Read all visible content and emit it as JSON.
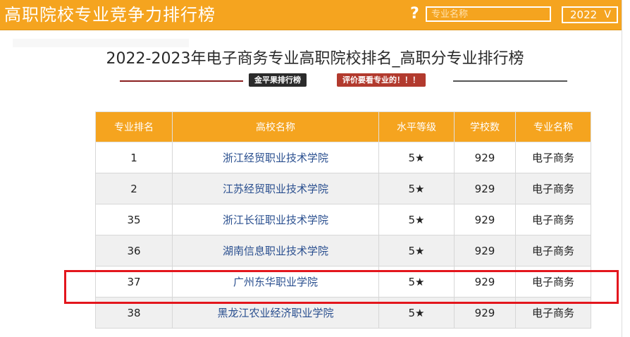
{
  "header": {
    "app_title": "高职院校专业竞争力排行榜",
    "help_icon": "?",
    "search_placeholder": "专业名称",
    "year_value": "2022",
    "year_chevron": "V"
  },
  "page": {
    "title": "2022-2023年电子商务专业高职院校排名_高职分专业排行榜",
    "badge_left": "金平果排行榜",
    "badge_right": "评价要看专业的！！！"
  },
  "table": {
    "headers": [
      "专业排名",
      "高校名称",
      "水平等级",
      "学校数",
      "专业名称"
    ],
    "rows": [
      {
        "rank": "1",
        "school": "浙江经贸职业技术学院",
        "level": "5★",
        "count": "929",
        "major": "电子商务"
      },
      {
        "rank": "2",
        "school": "江苏经贸职业技术学院",
        "level": "5★",
        "count": "929",
        "major": "电子商务"
      },
      {
        "rank": "35",
        "school": "浙江长征职业技术学院",
        "level": "5★",
        "count": "929",
        "major": "电子商务"
      },
      {
        "rank": "36",
        "school": "湖南信息职业技术学院",
        "level": "5★",
        "count": "929",
        "major": "电子商务"
      },
      {
        "rank": "37",
        "school": "广州东华职业学院",
        "level": "5★",
        "count": "929",
        "major": "电子商务"
      },
      {
        "rank": "38",
        "school": "黑龙江农业经济职业学院",
        "level": "5★",
        "count": "929",
        "major": "电子商务"
      }
    ]
  },
  "colors": {
    "accent": "#f5a41f",
    "highlight": "#e3161d",
    "school_link": "#2a4f8f"
  }
}
